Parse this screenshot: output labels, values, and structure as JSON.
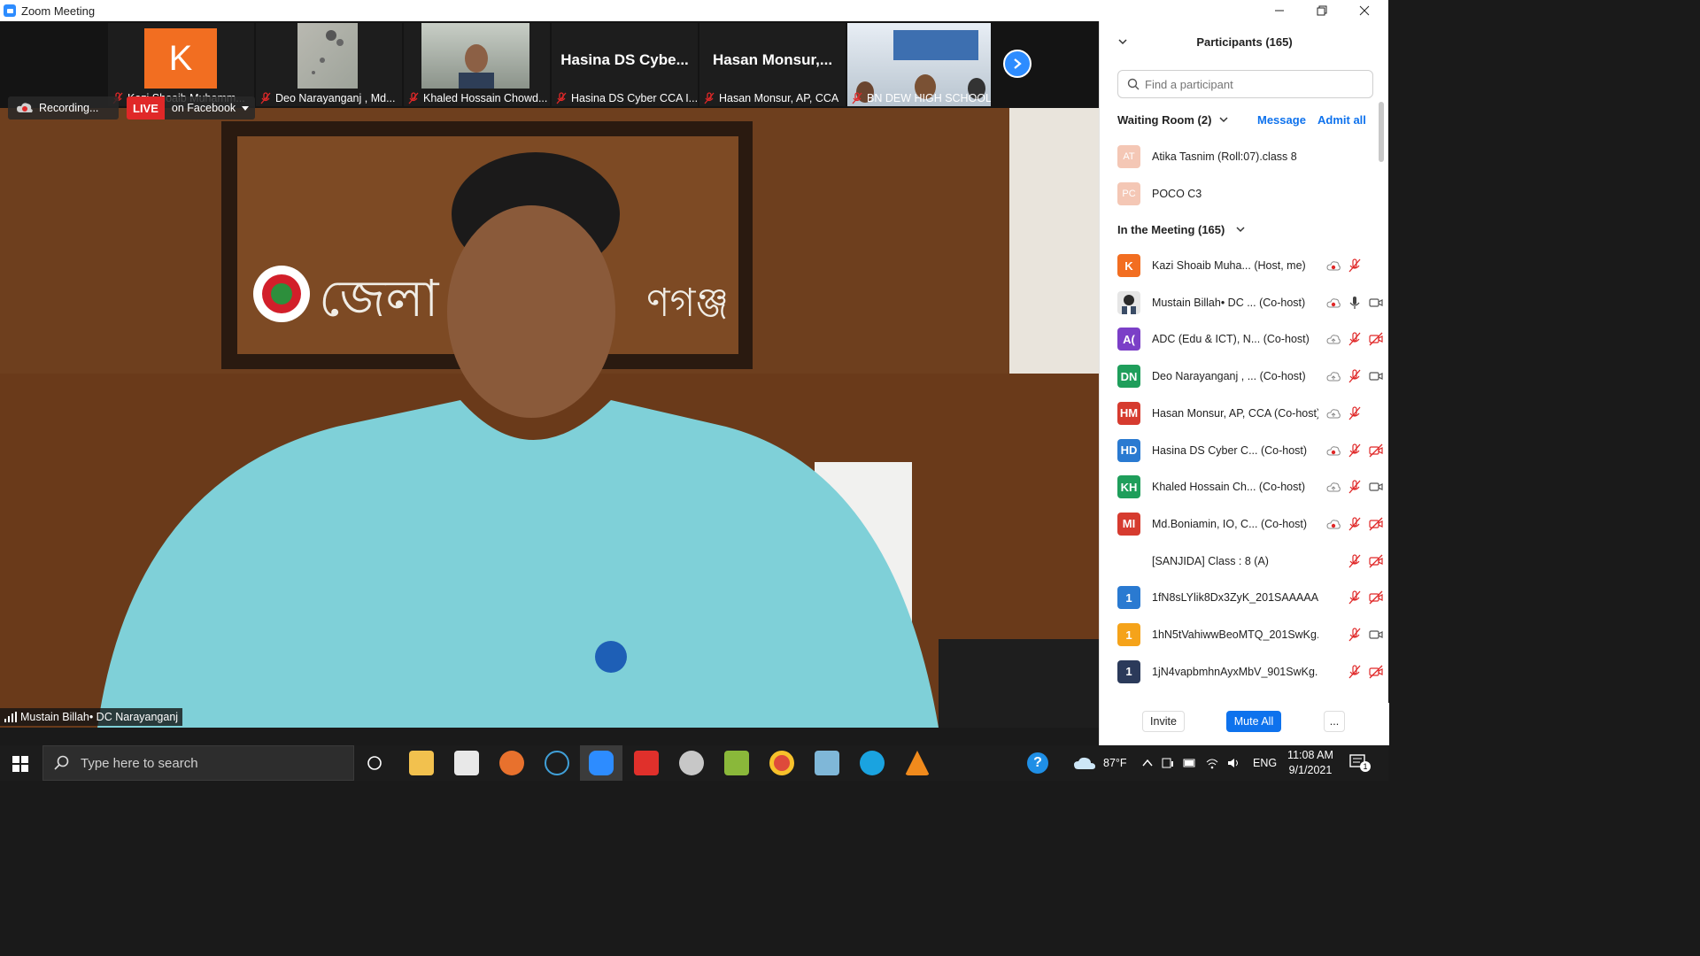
{
  "window": {
    "title": "Zoom Meeting"
  },
  "thumbnails": [
    {
      "label": "Kazi Shoaib Muhamm...",
      "avatar_letter": "K",
      "avatar_color": "#f26e21",
      "type": "avatar"
    },
    {
      "label": "Deo Narayanganj , Md...",
      "type": "video"
    },
    {
      "label": "Khaled Hossain Chowd...",
      "type": "video"
    },
    {
      "label": "Hasina DS Cyber CCA I...",
      "display_name": "Hasina DS Cybe...",
      "type": "name"
    },
    {
      "label": "Hasan Monsur, AP, CCA",
      "display_name": "Hasan Monsur,...",
      "type": "name"
    },
    {
      "label": "BN DEW HIGH SCHOOL",
      "type": "video"
    }
  ],
  "recording": {
    "label": "Recording..."
  },
  "live": {
    "badge": "LIVE",
    "destination": "on Facebook"
  },
  "main_speaker": {
    "label": "Mustain Billah• DC Narayanganj"
  },
  "participants_panel": {
    "title": "Participants (165)",
    "search_placeholder": "Find a participant",
    "waiting_room": {
      "heading": "Waiting Room (2)",
      "message_label": "Message",
      "admit_all_label": "Admit all",
      "people": [
        {
          "initials": "AT",
          "name": "Atika Tasnim (Roll:07).class 8",
          "color": "#f4c7b5"
        },
        {
          "initials": "PC",
          "name": "POCO C3",
          "color": "#f4c7b5"
        }
      ]
    },
    "in_meeting": {
      "heading": "In the Meeting (165)",
      "people": [
        {
          "initials": "K",
          "name": "Kazi Shoaib Muha...",
          "role": "(Host, me)",
          "color": "#f26e21",
          "rec": true,
          "mic": "muted",
          "video": "none"
        },
        {
          "initials": "",
          "name": "Mustain Billah• DC ...",
          "role": "(Co-host)",
          "color": "#dcdcdc",
          "rec": true,
          "mic": "on",
          "video": "on",
          "photo": true
        },
        {
          "initials": "A(",
          "name": "ADC (Edu & ICT), N...",
          "role": "(Co-host)",
          "color": "#7b3fc7",
          "rec": false,
          "mic": "muted",
          "video": "off"
        },
        {
          "initials": "DN",
          "name": "Deo Narayanganj , ...",
          "role": "(Co-host)",
          "color": "#1f9e5b",
          "rec": false,
          "mic": "muted",
          "video": "on"
        },
        {
          "initials": "HM",
          "name": "Hasan Monsur, AP, CCA",
          "role": "(Co-host)",
          "color": "#d63b2f",
          "rec": false,
          "mic": "muted",
          "video": "none"
        },
        {
          "initials": "HD",
          "name": "Hasina DS Cyber C...",
          "role": "(Co-host)",
          "color": "#2a7ad1",
          "rec": true,
          "mic": "muted",
          "video": "off"
        },
        {
          "initials": "KH",
          "name": "Khaled Hossain Ch...",
          "role": "(Co-host)",
          "color": "#1f9e5b",
          "rec": false,
          "mic": "muted",
          "video": "on"
        },
        {
          "initials": "MI",
          "name": "Md.Boniamin, IO, C...",
          "role": "(Co-host)",
          "color": "#d63b2f",
          "rec": true,
          "mic": "muted",
          "video": "off"
        },
        {
          "initials": "",
          "name": "[SANJIDA] Class : 8 (A)",
          "role": "",
          "color": "#ffffff",
          "rec": false,
          "mic": "muted",
          "video": "off",
          "noavatar": true
        },
        {
          "initials": "1",
          "name": "1fN8sLYlik8Dx3ZyK_201SAAAAA...",
          "role": "",
          "color": "#2a7ad1",
          "rec": false,
          "mic": "muted",
          "video": "off"
        },
        {
          "initials": "1",
          "name": "1hN5tVahiwwBeoMTQ_201SwKg...",
          "role": "",
          "color": "#f5a31a",
          "rec": false,
          "mic": "muted",
          "video": "on"
        },
        {
          "initials": "1",
          "name": "1jN4vapbmhnAyxMbV_901SwKg...",
          "role": "",
          "color": "#2b3a5a",
          "rec": false,
          "mic": "muted",
          "video": "off"
        }
      ]
    },
    "footer": {
      "invite_label": "Invite",
      "mute_all_label": "Mute All",
      "more_label": "..."
    }
  },
  "taskbar": {
    "search_placeholder": "Type here to search",
    "weather": "87°F",
    "language": "ENG",
    "time": "11:08 AM",
    "date": "9/1/2021",
    "notification_count": "1"
  }
}
